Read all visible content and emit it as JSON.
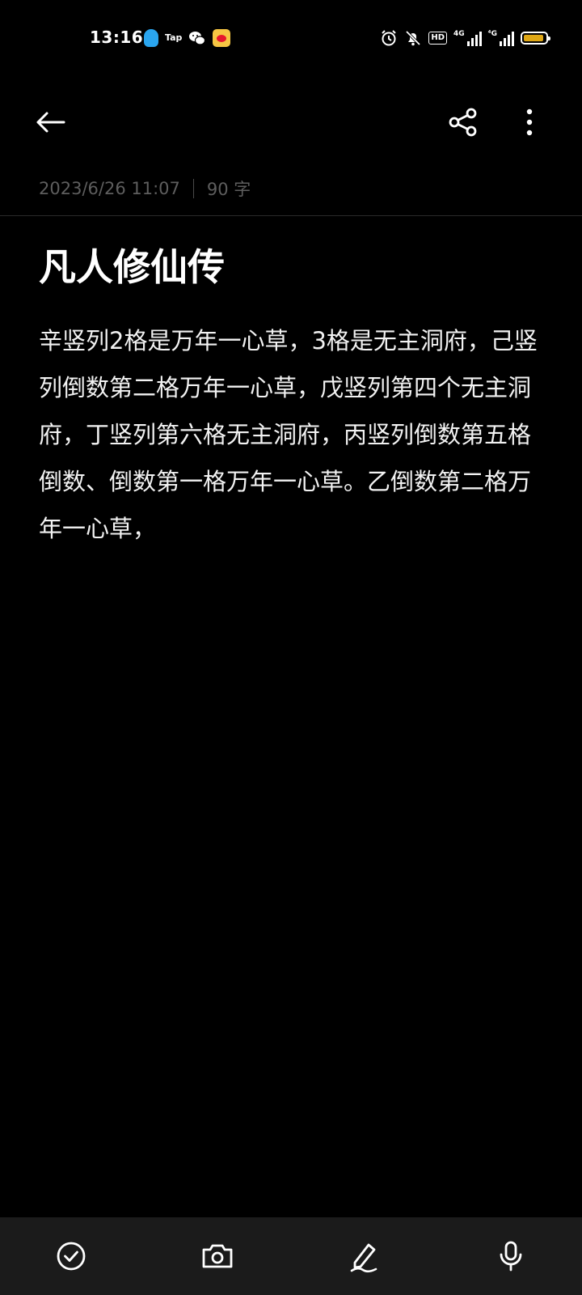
{
  "status_bar": {
    "time": "13:16",
    "left_icons": [
      "qq-icon",
      "taptap-icon",
      "wechat-icon",
      "weibo-icon"
    ],
    "tap_label": "Tap",
    "right_icons": [
      "alarm-icon",
      "mute-icon",
      "hd-icon",
      "signal-4g-icon",
      "signal-4g-icon",
      "battery-icon"
    ],
    "hd_label": "HD",
    "sim1_label": "4G",
    "sim2_label": "⁴G",
    "battery_color": "#e0a815"
  },
  "app_bar": {
    "back_icon": "back-arrow-icon",
    "share_icon": "share-icon",
    "more_icon": "more-vertical-icon"
  },
  "note": {
    "datetime": "2023/6/26 11:07",
    "word_count": "90 字",
    "title": "凡人修仙传",
    "body": "辛竖列2格是万年一心草，3格是无主洞府，己竖列倒数第二格万年一心草，戊竖列第四个无主洞府，丁竖列第六格无主洞府，丙竖列倒数第五格倒数、倒数第一格万年一心草。乙倒数第二格万年一心草，"
  },
  "bottom_bar": {
    "tools": [
      "checklist-icon",
      "camera-icon",
      "pen-icon",
      "microphone-icon"
    ]
  },
  "colors": {
    "background": "#000000",
    "toolbar_background": "#1b1b1b",
    "meta_text": "#5e5e5e",
    "body_text": "#f2f2f2"
  }
}
